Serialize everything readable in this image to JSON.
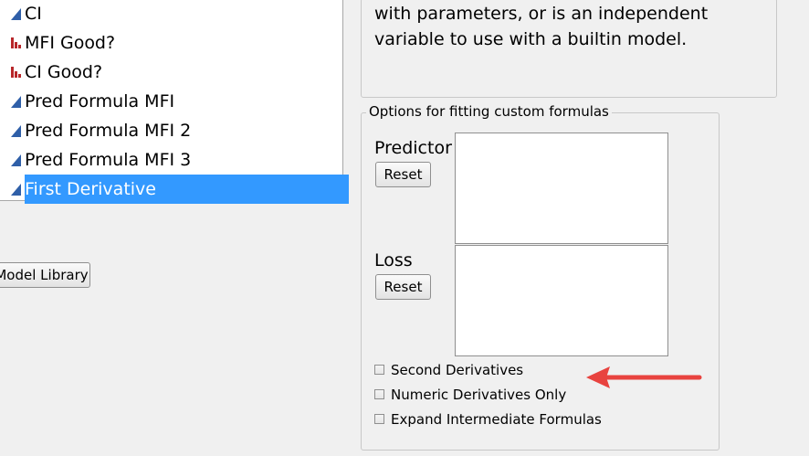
{
  "columns": {
    "items": [
      {
        "label": "CI",
        "icon": "continuous-icon"
      },
      {
        "label": "MFI Good?",
        "icon": "nominal-icon"
      },
      {
        "label": "CI Good?",
        "icon": "nominal-icon"
      },
      {
        "label": "Pred Formula MFI",
        "icon": "continuous-icon"
      },
      {
        "label": "Pred Formula MFI 2",
        "icon": "continuous-icon"
      },
      {
        "label": "Pred Formula MFI 3",
        "icon": "continuous-icon"
      },
      {
        "label": "First Derivative",
        "icon": "continuous-icon",
        "selected": true
      }
    ]
  },
  "model_library_label": "Model Library",
  "description": {
    "line1": "with parameters, or is an independent",
    "line2": "variable to use with a builtin model."
  },
  "options": {
    "legend": "Options for fitting custom formulas",
    "predictor_label": "Predictor",
    "loss_label": "Loss",
    "reset_label": "Reset",
    "second_derivatives_label": "Second Derivatives",
    "numeric_derivatives_label": "Numeric Derivatives Only",
    "expand_formulas_label": "Expand Intermediate Formulas"
  },
  "colors": {
    "selection": "#3399ff",
    "continuous_icon": "#2f5fa8",
    "nominal_icon": "#b8272a",
    "annotation_arrow": "#e8433f"
  }
}
